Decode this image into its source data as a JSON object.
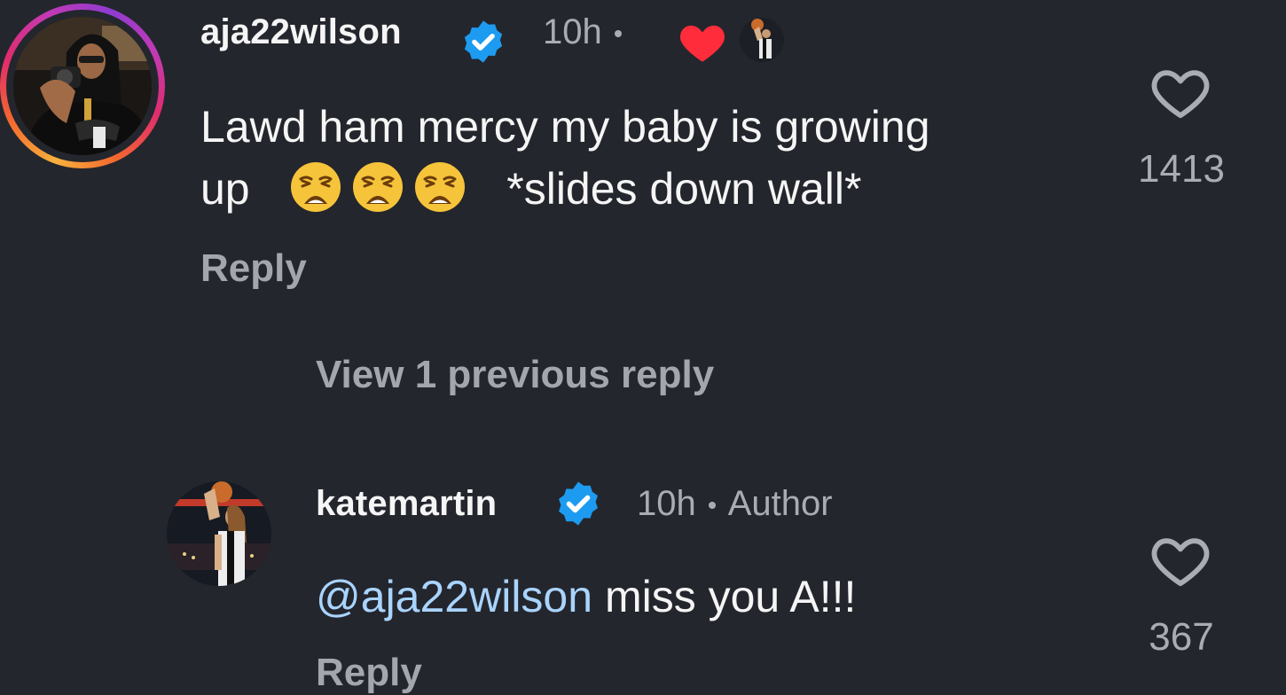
{
  "comments": [
    {
      "username": "aja22wilson",
      "verified": true,
      "time": "10h",
      "liked_by_author": true,
      "text_line1": "Lawd ham mercy my baby is growing",
      "text_prefix": "up",
      "emoji": "weary-face",
      "emoji_count": 3,
      "text_suffix": "*slides down wall*",
      "reply_label": "Reply",
      "like_count": "1413"
    },
    {
      "username": "katemartin",
      "verified": true,
      "time": "10h",
      "author_label": "Author",
      "mention": "@aja22wilson",
      "text": "miss you A!!!",
      "like_count": "367",
      "reply_label": "Reply"
    }
  ],
  "view_previous_replies": "View 1 previous reply",
  "colors": {
    "background": "#24262d",
    "verified_badge": "#1d9bf0",
    "heart": "#ff2d3b",
    "mention": "#a9d4ff",
    "secondary_text": "#a9acb3"
  },
  "icons": {
    "verified": "verified-badge-icon",
    "liked_by_author": "heart-icon",
    "like": "heart-outline-icon"
  }
}
